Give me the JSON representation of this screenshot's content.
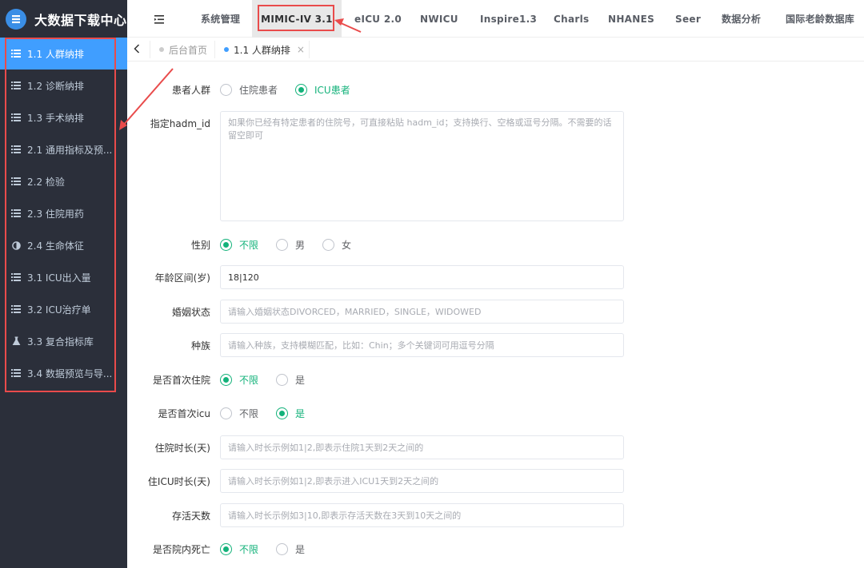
{
  "brand": {
    "title": "大数据下载中心"
  },
  "sidebar": {
    "items": [
      {
        "label": "1.1 人群纳排",
        "icon": "list-icon",
        "active": true
      },
      {
        "label": "1.2 诊断纳排",
        "icon": "list-icon"
      },
      {
        "label": "1.3 手术纳排",
        "icon": "list-icon"
      },
      {
        "label": "2.1 通用指标及预...",
        "icon": "list-icon"
      },
      {
        "label": "2.2 检验",
        "icon": "list-icon"
      },
      {
        "label": "2.3 住院用药",
        "icon": "list-icon"
      },
      {
        "label": "2.4 生命体征",
        "icon": "half-circle-icon"
      },
      {
        "label": "3.1 ICU出入量",
        "icon": "list-icon"
      },
      {
        "label": "3.2 ICU治疗单",
        "icon": "list-icon"
      },
      {
        "label": "3.3 复合指标库",
        "icon": "flask-icon"
      },
      {
        "label": "3.4 数据预览与导...",
        "icon": "list-icon"
      }
    ]
  },
  "topnav": {
    "tabs": [
      {
        "label": "系统管理"
      },
      {
        "label": "MIMIC-IV 3.1",
        "active": true
      },
      {
        "label": "eICU 2.0"
      },
      {
        "label": "NWICU"
      },
      {
        "label": "Inspire1.3"
      },
      {
        "label": "Charls"
      },
      {
        "label": "NHANES"
      },
      {
        "label": "Seer"
      },
      {
        "label": "数据分析"
      },
      {
        "label": "国际老龄数据库"
      }
    ]
  },
  "tagsbar": {
    "tags": [
      {
        "label": "后台首页",
        "active": false
      },
      {
        "label": "1.1 人群纳排",
        "active": true,
        "close": "×"
      }
    ]
  },
  "form": {
    "population": {
      "label": "患者人群",
      "options": [
        "住院患者",
        "ICU患者"
      ],
      "selected": 1
    },
    "hadm": {
      "label": "指定hadm_id",
      "placeholder": "如果你已经有特定患者的住院号，可直接粘贴 hadm_id；支持换行、空格或逗号分隔。不需要的话留空即可",
      "value": ""
    },
    "gender": {
      "label": "性别",
      "options": [
        "不限",
        "男",
        "女"
      ],
      "selected": 0
    },
    "age": {
      "label": "年龄区间(岁)",
      "value": "18|120",
      "placeholder": ""
    },
    "marital": {
      "label": "婚姻状态",
      "placeholder": "请输入婚姻状态DIVORCED，MARRIED，SINGLE，WIDOWED",
      "value": ""
    },
    "race": {
      "label": "种族",
      "placeholder": "请输入种族，支持模糊匹配，比如：Chin；多个关键词可用逗号分隔",
      "value": ""
    },
    "first_admission": {
      "label": "是否首次住院",
      "options": [
        "不限",
        "是"
      ],
      "selected": 0
    },
    "first_icu": {
      "label": "是否首次icu",
      "options": [
        "不限",
        "是"
      ],
      "selected": 1
    },
    "los_hosp": {
      "label": "住院时长(天)",
      "placeholder": "请输入时长示例如1|2,即表示住院1天到2天之间的",
      "value": ""
    },
    "los_icu": {
      "label": "住ICU时长(天)",
      "placeholder": "请输入时长示例如1|2,即表示进入ICU1天到2天之间的",
      "value": ""
    },
    "survival": {
      "label": "存活天数",
      "placeholder": "请输入时长示例如3|10,即表示存活天数在3天到10天之间的",
      "value": ""
    },
    "hosp_death": {
      "label": "是否院内死亡",
      "options": [
        "不限",
        "是"
      ],
      "selected": 0
    }
  },
  "colors": {
    "sidebar_bg": "#2b2f3a",
    "active_blue": "#409eff",
    "radio_green": "#13b27a",
    "highlight_red": "#e94b4b"
  }
}
